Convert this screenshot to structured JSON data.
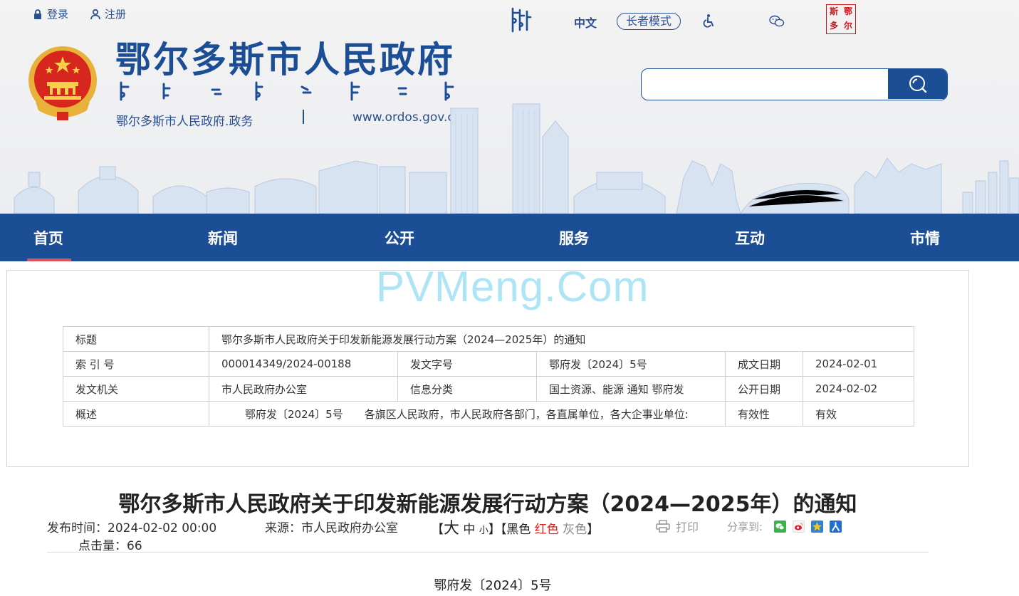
{
  "topbar": {
    "login": "登录",
    "register": "注册",
    "lang_zh": "中文",
    "elder_mode": "长者模式",
    "ordos_logo_chars": [
      "鄂",
      "尔",
      "多",
      "斯"
    ]
  },
  "header": {
    "site_title": "鄂尔多斯市人民政府",
    "sub_site": "鄂尔多斯市人民政府.政务",
    "sub_url": "www.ordos.gov.cn"
  },
  "search": {
    "placeholder": ""
  },
  "nav": {
    "items": [
      "首页",
      "新闻",
      "公开",
      "服务",
      "互动",
      "市情"
    ],
    "active_index": 0
  },
  "watermark": "PVMeng.Com",
  "meta": {
    "title_label": "标题",
    "title_value": "鄂尔多斯市人民政府关于印发新能源发展行动方案（2024—2025年）的通知",
    "index_label": "索 引 号",
    "index_value": "000014349/2024-00188",
    "docno_label": "发文字号",
    "docno_value": "鄂府发〔2024〕5号",
    "date_label": "成文日期",
    "date_value": "2024-02-01",
    "org_label": "发文机关",
    "org_value": "市人民政府办公室",
    "category_label": "信息分类",
    "category_value": "国土资源、能源  通知  鄂府发",
    "pub_label": "公开日期",
    "pub_value": "2024-02-02",
    "summary_label": "概述",
    "summary_value": "鄂府发〔2024〕5号　　各旗区人民政府，市人民政府各部门，各直属单位，各大企事业单位:",
    "validity_label": "有效性",
    "validity_value": "有效"
  },
  "article": {
    "title": "鄂尔多斯市人民政府关于印发新能源发展行动方案（2024—2025年）的通知",
    "publish_time": "发布时间：2024-02-02 00:00",
    "source": "来源：市人民政府办公室",
    "size_open": "【",
    "size_big": "大",
    "size_mid": "中",
    "size_small": "小",
    "size_close": "】",
    "color_open": "【黑色",
    "color_red": "红色",
    "color_gray": "灰色",
    "color_close": "】",
    "print": "打印",
    "share_label": "分享到:",
    "hits": "点击量：66",
    "doc_number": "鄂府发〔2024〕5号"
  },
  "colors": {
    "brand_blue": "#1c4e96",
    "active_underline": "#d9535a",
    "watermark": "#9fe0f5"
  },
  "icons": [
    "lock-icon",
    "user-icon",
    "mongolian-script-icon",
    "accessibility-icon",
    "wechat-icon",
    "search-icon",
    "printer-icon",
    "share-wechat-icon",
    "share-weibo-icon",
    "share-qzone-icon",
    "share-renren-icon"
  ]
}
